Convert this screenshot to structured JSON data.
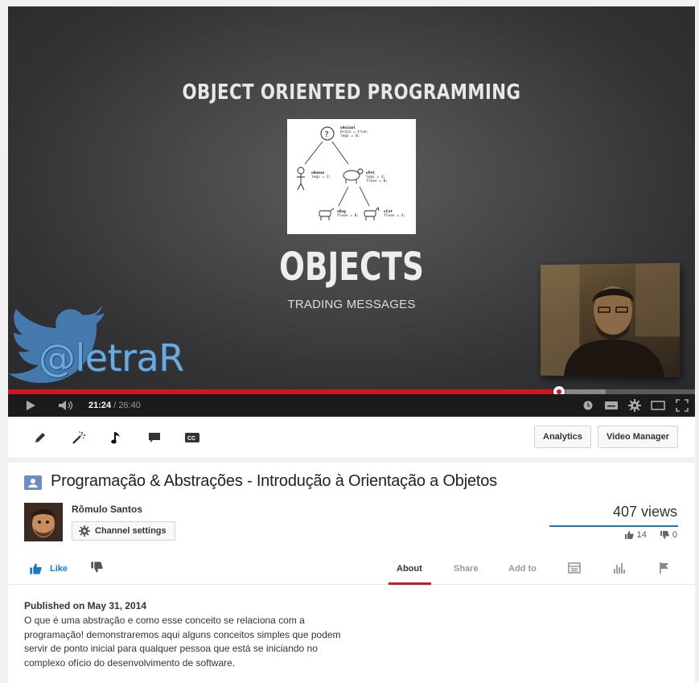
{
  "player": {
    "slide": {
      "title": "OBJECT ORIENTED PROGRAMMING",
      "heading": "OBJECTS",
      "subheading": "TRADING MESSAGES",
      "twitter_handle": "@letraR",
      "diagram_labels": {
        "root": "oAnimal",
        "root_props": [
          "brain = true;",
          "legs = 0;"
        ],
        "left": "oHuman",
        "left_props": [
          "legs = 2;"
        ],
        "right": "oPet",
        "right_props": [
          "legs = 4;",
          "fleas = 0;"
        ],
        "bottom_left": "oDog",
        "bottom_left_props": [
          "fleas = 8;"
        ],
        "bottom_right": "oCat",
        "bottom_right_props": [
          "fleas = 4;"
        ]
      }
    },
    "current_time": "21:24",
    "time_separator": " / ",
    "duration": "26:40",
    "progress_fraction": 0.8025,
    "buffered_fraction": 0.87,
    "icons": [
      "play-icon",
      "volume-icon",
      "watch-later-icon",
      "subtitles-icon",
      "settings-icon",
      "size-icon",
      "fullscreen-icon"
    ]
  },
  "toolbar": {
    "tools": [
      "edit-icon",
      "enhancements-icon",
      "audio-icon",
      "annotations-icon",
      "captions-icon"
    ],
    "analytics_label": "Analytics",
    "video_manager_label": "Video Manager"
  },
  "info": {
    "title": "Programação & Abstrações - Introdução à Orientação a Objetos",
    "owner": "Rômulo Santos",
    "channel_settings_label": "Channel settings",
    "views": "407 views",
    "likes": "14",
    "dislikes": "0",
    "like_label": "Like",
    "tabs": {
      "about": "About",
      "share": "Share",
      "add_to": "Add to"
    },
    "published": "Published on May 31, 2014",
    "description": "O que é uma abstração e como esse conceito se relaciona com a programação! demonstraremos aqui alguns conceitos simples que podem servir de ponto inicial para qualquer pessoa que está se iniciando no complexo ofício do desenvolvimento de software."
  },
  "colors": {
    "accent_red": "#cc181e",
    "link_blue": "#167ac6",
    "twitter_blue": "#6fa9da"
  }
}
